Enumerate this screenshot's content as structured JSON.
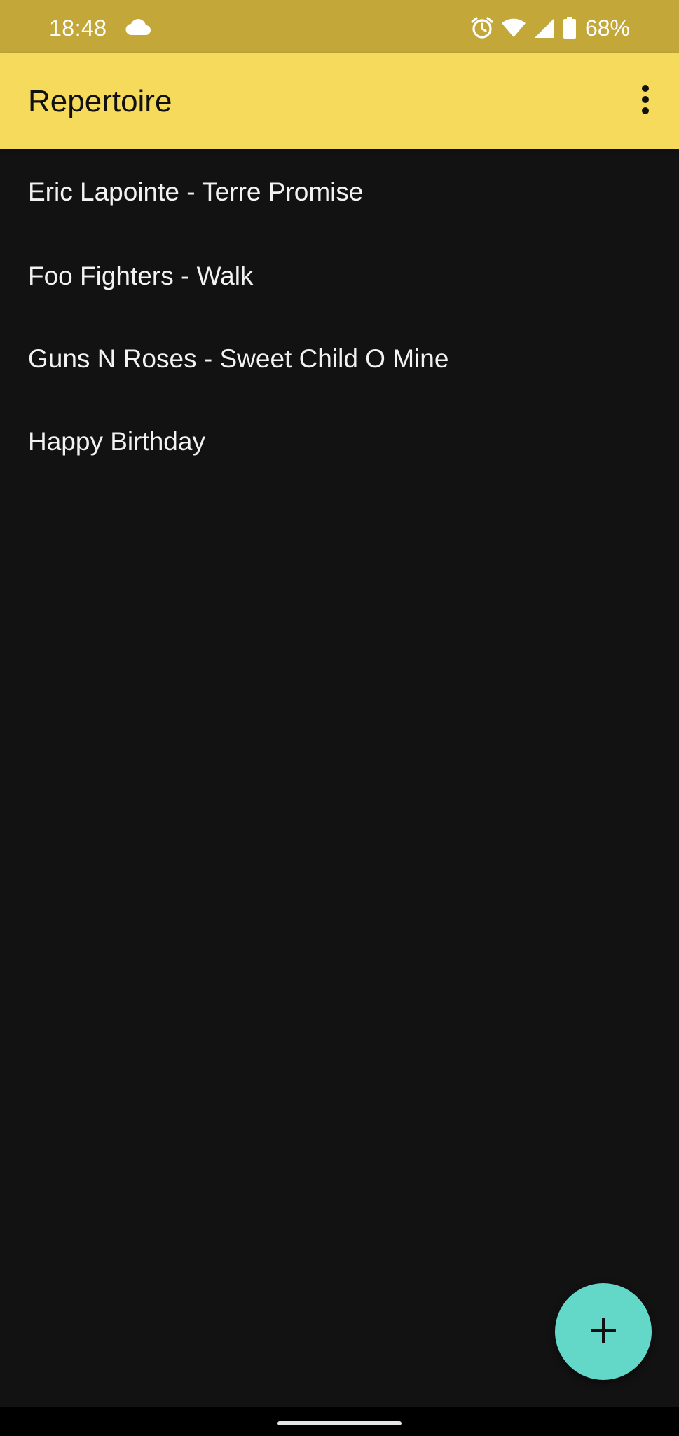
{
  "status_bar": {
    "time": "18:48",
    "battery_percent": "68%",
    "icons": [
      "cloud-icon",
      "alarm-icon",
      "wifi-icon",
      "signal-icon",
      "battery-icon"
    ]
  },
  "app_bar": {
    "title": "Repertoire",
    "menu_icon": "more-vert-icon"
  },
  "songs": [
    {
      "label": "Eric Lapointe - Terre Promise"
    },
    {
      "label": "Foo Fighters - Walk"
    },
    {
      "label": "Guns N Roses - Sweet Child O Mine"
    },
    {
      "label": "Happy Birthday"
    }
  ],
  "fab": {
    "icon": "add-icon"
  },
  "colors": {
    "status_bar": "#c3a738",
    "app_bar": "#f6da5b",
    "background": "#121212",
    "fab": "#64d8c8",
    "text": "#f2f2f2"
  }
}
